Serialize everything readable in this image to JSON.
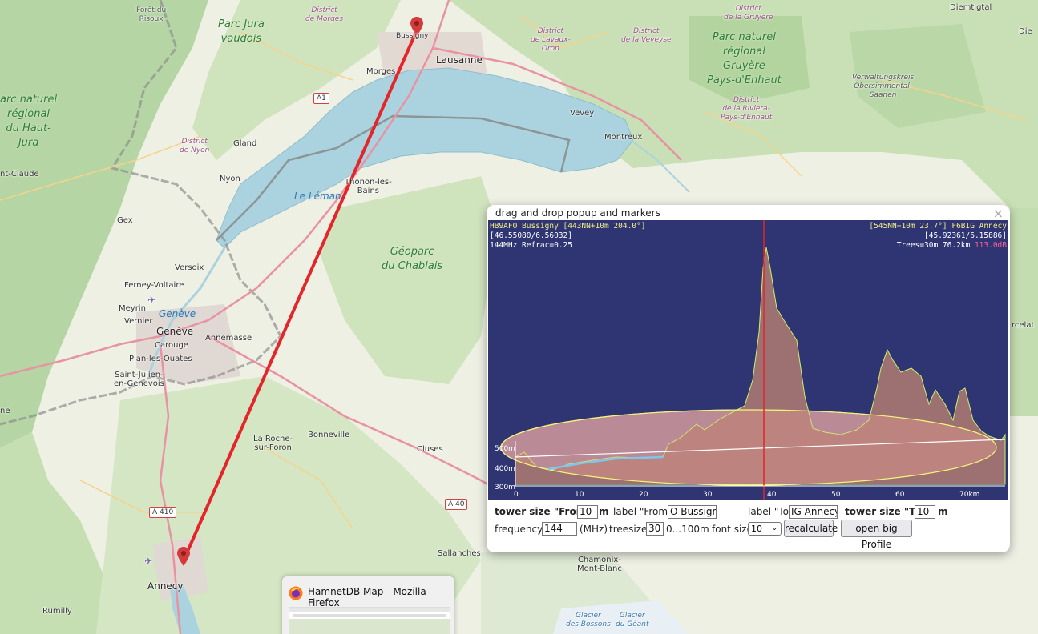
{
  "map": {
    "places": {
      "foret_risoux": "Forêt du\nRisoux",
      "parc_jura_vaudois": "Parc Jura\nvaudois",
      "district_morges": "District\nde Morges",
      "bussigny": "Bussigny",
      "lausanne": "Lausanne",
      "morges": "Morges",
      "district_lavaux": "District\nde Lavaux-\nOron",
      "district_veveyse": "District\nde la Veveyse",
      "district_gruyere": "District\nde la Gruyère",
      "parc_gruyere": "Parc naturel\nrégional\nGruyère\nPays-d'Enhaut",
      "diemtigtal": "Diemtigtal",
      "verwaltung": "Verwaltungskreis\nObersimmental-\nSaanen",
      "vevey": "Vevey",
      "montreux": "Montreux",
      "district_riviera": "District\nde la Riviera-\nPays-d'Enhaut",
      "parc_haut_jura": "arc naturel\nrégional\ndu Haut-\nJura",
      "district_nyon": "District\nde Nyon",
      "gland": "Gland",
      "nyon": "Nyon",
      "le_leman": "Le Léman",
      "thonon": "Thonon-les-\nBains",
      "st_claude": "nt-Claude",
      "gex": "Gex",
      "geoparc": "Géoparc\ndu Chablais",
      "versoix": "Versoix",
      "ferney": "Ferney-Voltaire",
      "meyrin": "Meyrin",
      "geneve_lake": "Genève",
      "vernier": "Vernier",
      "geneve": "Genève",
      "carouge": "Carouge",
      "annemasse": "Annemasse",
      "plan_les_ouates": "Plan-les-Ouates",
      "st_julien": "Saint-Julien-\nen-Genevois",
      "bonneville": "Bonneville",
      "la_roche": "La Roche-\nsur-Foron",
      "cluses": "Cluses",
      "sallanches": "Sallanches",
      "chamonix": "Chamonix-\nMont-Blanc",
      "annecy": "Annecy",
      "rumilly": "Rumilly",
      "glacier_bossons": "Glacier\ndes Bossons",
      "glacier_geant": "Glacier\ndu Géant",
      "nne": "ne",
      "die": "Die",
      "rcelat": "rcelat"
    },
    "roads": {
      "a1": "A1",
      "a410": "A 410",
      "a40": "A 40"
    },
    "colors": {
      "path": "#e3262a",
      "lake": "#aad3df",
      "forest": "#add19e",
      "marker": "#d33a3a"
    }
  },
  "popup": {
    "title": "drag and drop popup and markers",
    "close": "×",
    "profile": {
      "left_line1": "HB9AFO Bussigny [443NN+10m 204.0°]",
      "left_line2": "[46.55080/6.56032]",
      "left_line3": "144MHz Refrac=0.25",
      "right_line1": "[545NN+10m 23.7°] F6BIG Annecy",
      "right_line2": "[45.92361/6.15886]",
      "right_line3a": "Trees=30m 76.2km ",
      "right_line3b": "113.0dB",
      "y_labels": [
        "500m",
        "400m",
        "300m"
      ],
      "x_labels": [
        "0",
        "10",
        "20",
        "30",
        "40",
        "50",
        "60",
        "70km"
      ]
    },
    "controls": {
      "tower_from_label": "tower size \"From\"",
      "tower_from_value": "10",
      "tower_from_unit": "m",
      "label_from_label": "label \"From\"",
      "label_from_value": "O Bussigny",
      "label_to_label": "label \"To\"",
      "label_to_value": "IG Annecy",
      "tower_to_label": "tower size \"To\"",
      "tower_to_value": "10",
      "tower_to_unit": "m",
      "frequency_label": "frequency:",
      "frequency_value": "144",
      "frequency_unit": "(MHz)",
      "treesize_label": "treesize:",
      "treesize_value": "30",
      "treesize_range": "0...100m",
      "fontsize_label": "font size",
      "fontsize_value": "10",
      "recalculate": "recalculate",
      "open_big": "open big Profile"
    }
  },
  "taskbar": {
    "title": "HamnetDB Map - Mozilla Firefox"
  }
}
